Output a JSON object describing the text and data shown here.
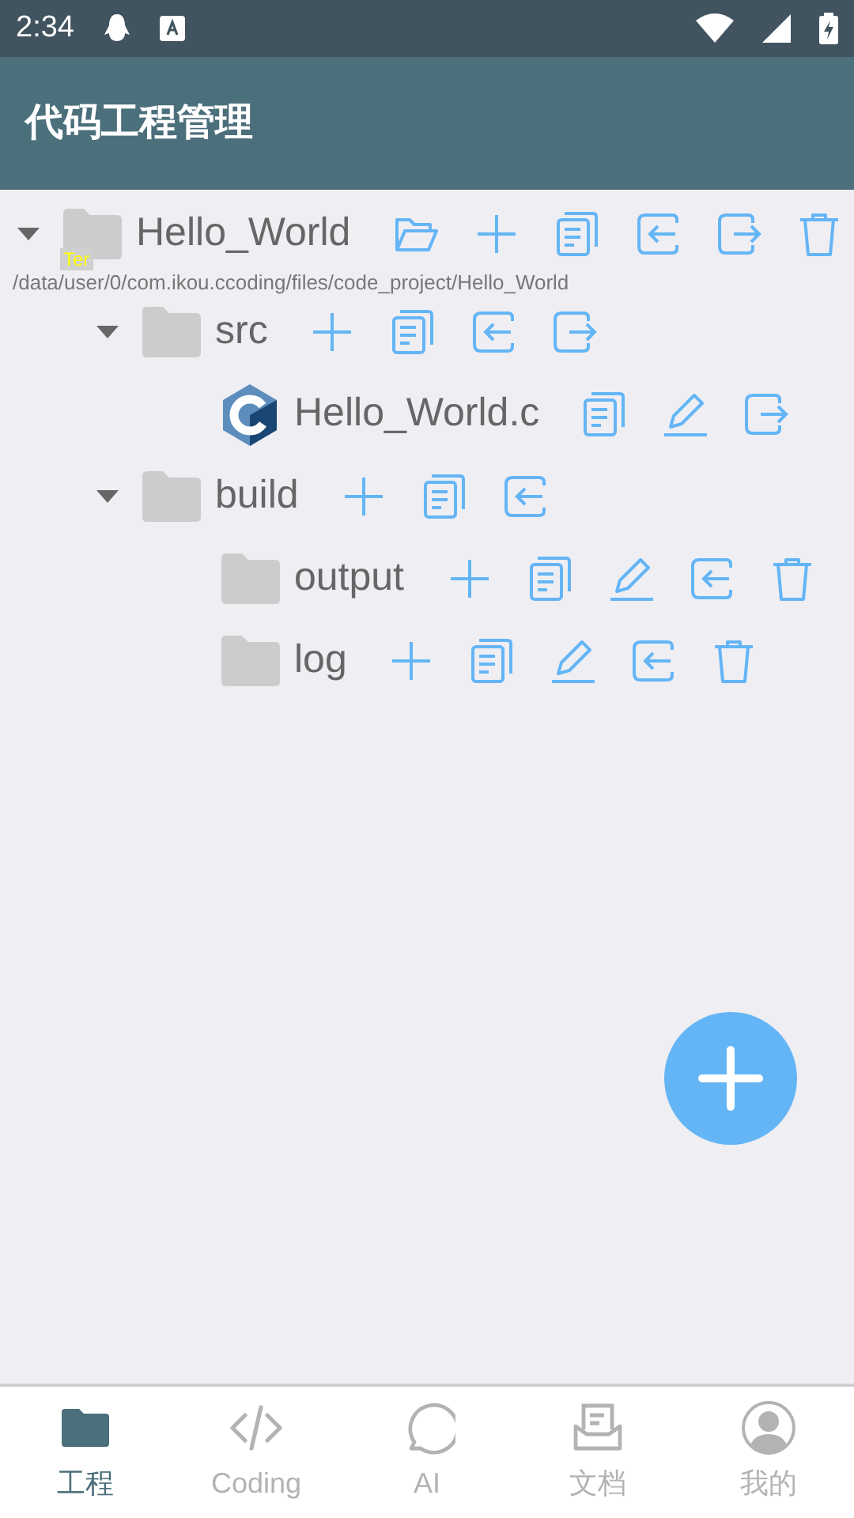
{
  "status_bar": {
    "time": "2:34"
  },
  "app_bar": {
    "title": "代码工程管理"
  },
  "tree": [
    {
      "name": "Hello_World",
      "kind": "folder",
      "expanded": true,
      "badge": "Ter",
      "path": "/data/user/0/com.ikou.ccoding/files/code_project/Hello_World",
      "actions": [
        {
          "kind": "open"
        },
        {
          "kind": "add"
        },
        {
          "kind": "copy"
        },
        {
          "kind": "import"
        },
        {
          "kind": "export"
        },
        {
          "kind": "delete"
        }
      ],
      "children": [
        {
          "name": "src",
          "kind": "folder",
          "expanded": true,
          "actions": [
            {
              "kind": "add"
            },
            {
              "kind": "copy"
            },
            {
              "kind": "import"
            },
            {
              "kind": "export"
            }
          ],
          "children": [
            {
              "name": "Hello_World.c",
              "kind": "c_file",
              "actions": [
                {
                  "kind": "copy"
                },
                {
                  "kind": "rename"
                },
                {
                  "kind": "export"
                }
              ]
            }
          ]
        },
        {
          "name": "build",
          "kind": "folder",
          "expanded": true,
          "actions": [
            {
              "kind": "add"
            },
            {
              "kind": "copy"
            },
            {
              "kind": "import"
            }
          ],
          "children": [
            {
              "name": "output",
              "kind": "folder",
              "actions": [
                {
                  "kind": "add"
                },
                {
                  "kind": "copy"
                },
                {
                  "kind": "rename"
                },
                {
                  "kind": "import"
                },
                {
                  "kind": "delete"
                }
              ]
            },
            {
              "name": "log",
              "kind": "folder",
              "actions": [
                {
                  "kind": "add"
                },
                {
                  "kind": "copy"
                },
                {
                  "kind": "rename"
                },
                {
                  "kind": "import"
                },
                {
                  "kind": "delete"
                }
              ]
            }
          ]
        }
      ]
    }
  ],
  "bottom_nav": [
    {
      "label": "工程",
      "kind": "folder",
      "selected": true
    },
    {
      "label": "Coding",
      "kind": "code",
      "selected": false
    },
    {
      "label": "AI",
      "kind": "ai",
      "selected": false
    },
    {
      "label": "文档",
      "kind": "doc",
      "selected": false
    },
    {
      "label": "我的",
      "kind": "person",
      "selected": false
    }
  ]
}
